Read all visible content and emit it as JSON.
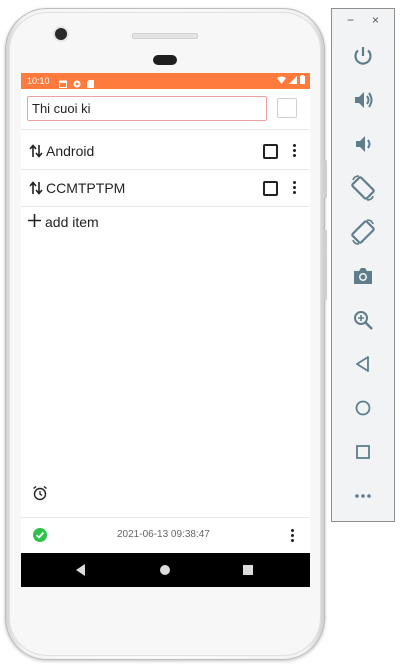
{
  "status_bar": {
    "time": "10:10"
  },
  "todo": {
    "title_value": "Thi cuoi ki",
    "items": [
      {
        "label": "Android"
      },
      {
        "label": "CCMTPTPM"
      }
    ],
    "add_item_label": "add item",
    "footer": {
      "timestamp": "2021-06-13 09:38:47"
    }
  },
  "accent_color": "#ff7a3c",
  "sync_ok_color": "#2ec24a",
  "icons": {
    "statusbar": [
      "calendar-icon",
      "settings-icon",
      "sd-card-icon",
      "wifi-icon",
      "signal-icon",
      "battery-icon"
    ],
    "row": [
      "sort-icon",
      "checkbox-icon",
      "more-vert-icon"
    ],
    "footer": [
      "check-circle-icon",
      "more-vert-icon"
    ],
    "alarm": "alarm-icon",
    "navigation": [
      "back-icon",
      "home-icon",
      "overview-icon"
    ],
    "toolbar": [
      "power-icon",
      "volume-up-icon",
      "volume-down-icon",
      "rotate-left-icon",
      "rotate-right-icon",
      "camera-icon",
      "zoom-in-icon",
      "back-icon",
      "home-icon",
      "overview-icon",
      "more-icon"
    ]
  },
  "toolbar": {
    "minimize_glyph": "−",
    "close_glyph": "×"
  }
}
